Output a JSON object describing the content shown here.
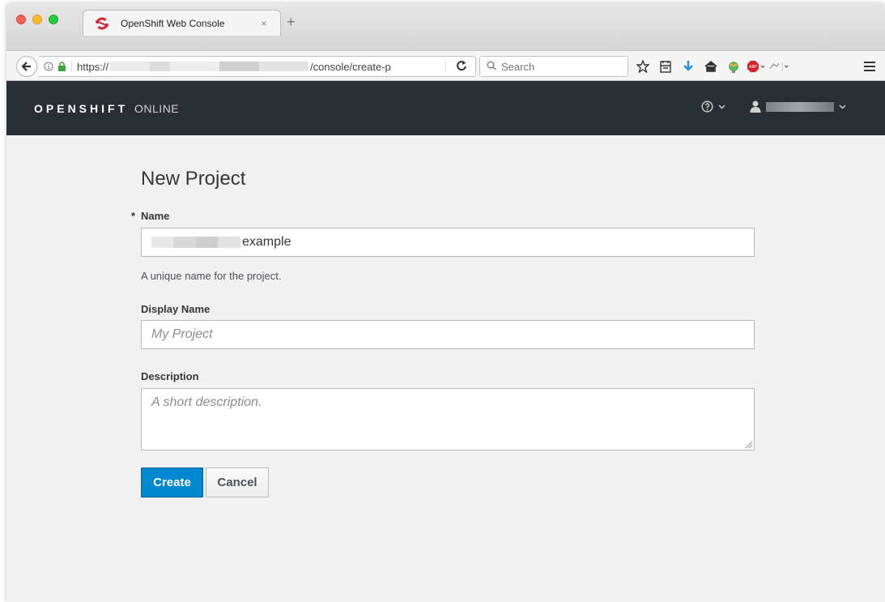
{
  "browser": {
    "tab_title": "OpenShift Web Console",
    "tab_close": "×",
    "new_tab": "+",
    "url_prefix": "https://",
    "url_suffix": "/console/create-p",
    "search_placeholder": "Search",
    "reload": "C"
  },
  "masthead": {
    "brand_bold": "OPENSHIFT",
    "brand_light": "ONLINE"
  },
  "form": {
    "title": "New Project",
    "required_marker": "*",
    "name_label": "Name",
    "name_value": "example",
    "name_help": "A unique name for the project.",
    "display_name_label": "Display Name",
    "display_name_placeholder": "My Project",
    "description_label": "Description",
    "description_placeholder": "A short description.",
    "create_label": "Create",
    "cancel_label": "Cancel"
  },
  "colors": {
    "masthead_bg": "#292e34",
    "primary_button": "#0088ce",
    "page_bg": "#f1f1f1"
  }
}
